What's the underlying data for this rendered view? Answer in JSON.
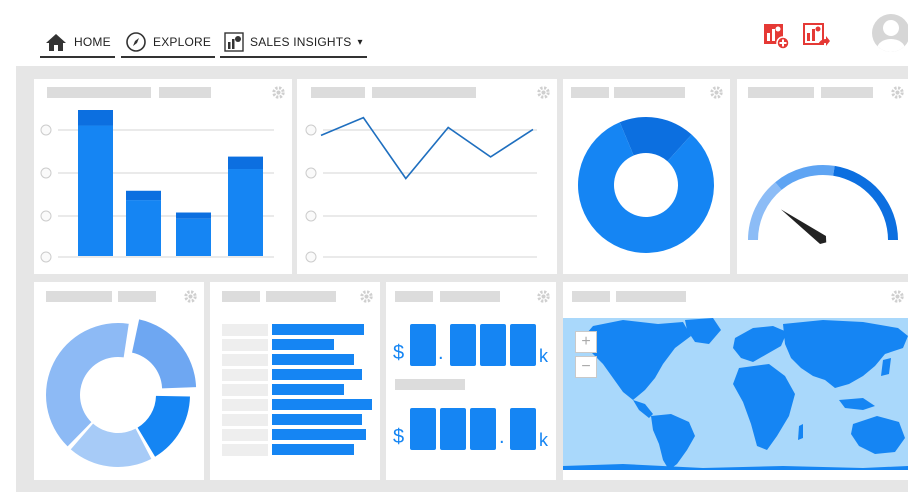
{
  "nav": {
    "home_label": "HOME",
    "explore_label": "EXPLORE",
    "insights_label": "SALES INSIGHTS",
    "insights_caret": "▾"
  },
  "actions": {
    "icons": [
      "add-report-icon",
      "share-report-icon"
    ],
    "accent": "#e53935"
  },
  "widgets": {
    "kpi_one": {
      "prefix": "$",
      "separator": ".",
      "suffix": "k"
    },
    "kpi_two": {
      "prefix": "$",
      "separator": ".",
      "suffix": "k"
    },
    "map": {
      "zoom_in": "+",
      "zoom_out": "−"
    }
  },
  "colors": {
    "primary": "#1585f3",
    "dark": "#0c6fe0",
    "light": "#8cbcf6",
    "placeholder": "#dcdcdc",
    "background": "#e6e6e6",
    "ocean": "#a9d8fb"
  },
  "chart_data": [
    {
      "type": "bar",
      "categories": [
        "",
        "",
        "",
        ""
      ],
      "series": [
        {
          "values": [
            4.2,
            1.8,
            1.2,
            2.8
          ]
        },
        {
          "values": [
            0.5,
            0.3,
            0.2,
            0.4
          ]
        }
      ],
      "stacked": true,
      "ylim": [
        0,
        4.7
      ],
      "grid": true
    },
    {
      "type": "line",
      "x": [
        1,
        2,
        3,
        4,
        5,
        6
      ],
      "y": [
        6.2,
        7.1,
        4.0,
        6.6,
        5.1,
        6.5
      ],
      "ylim": [
        0,
        8
      ],
      "grid": true
    },
    {
      "type": "pie",
      "donut": true,
      "values": [
        82,
        18
      ]
    },
    {
      "type": "gauge",
      "value": 0.2
    },
    {
      "type": "pie",
      "donut": true,
      "values": [
        22,
        17,
        20,
        41
      ],
      "exploded_index": 0
    },
    {
      "type": "bar",
      "orientation": "horizontal",
      "values": [
        92,
        62,
        82,
        90,
        72,
        100,
        90,
        94,
        82
      ]
    }
  ]
}
